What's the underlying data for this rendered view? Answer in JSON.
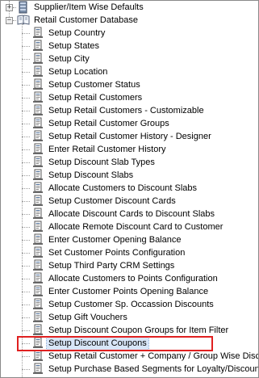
{
  "tree": {
    "top_items": [
      {
        "label": "Supplier/Item Wise Defaults",
        "expander": "+",
        "icon": "stack-icon"
      },
      {
        "label": "Retail Customer Database",
        "expander": "−",
        "icon": "book-icon"
      }
    ],
    "children": [
      {
        "label": "Setup Country"
      },
      {
        "label": "Setup States"
      },
      {
        "label": "Setup City"
      },
      {
        "label": "Setup Location"
      },
      {
        "label": "Setup Customer Status"
      },
      {
        "label": "Setup Retail Customers"
      },
      {
        "label": "Setup Retail Customers - Customizable"
      },
      {
        "label": "Setup Retail Customer Groups"
      },
      {
        "label": "Setup Retail Customer History - Designer"
      },
      {
        "label": "Enter Retail Customer History"
      },
      {
        "label": "Setup Discount Slab Types"
      },
      {
        "label": "Setup Discount Slabs"
      },
      {
        "label": "Allocate Customers to Discount Slabs"
      },
      {
        "label": "Setup Customer Discount Cards"
      },
      {
        "label": "Allocate Discount Cards to Discount Slabs"
      },
      {
        "label": "Allocate Remote Discount Card to Customer"
      },
      {
        "label": "Enter Customer Opening Balance"
      },
      {
        "label": "Set Customer Points Configuration"
      },
      {
        "label": "Setup Third Party CRM Settings"
      },
      {
        "label": "Allocate Customers to Points Configuration"
      },
      {
        "label": "Enter Customer Points Opening Balance"
      },
      {
        "label": "Setup Customer Sp. Occassion Discounts"
      },
      {
        "label": "Setup Gift Vouchers"
      },
      {
        "label": "Setup Discount Coupon Groups for Item Filter"
      },
      {
        "label": "Setup Discount Coupons",
        "selected": true
      },
      {
        "label": "Setup Retail Customer + Company / Group Wise Discou"
      },
      {
        "label": "Setup Purchase Based Segments for Loyalty/Discount"
      }
    ],
    "child_icon": "document-icon",
    "colors": {
      "selection_fill": "#d8e6f8",
      "highlight_border": "#e02020",
      "guide_lines": "#a0a0a0"
    }
  }
}
